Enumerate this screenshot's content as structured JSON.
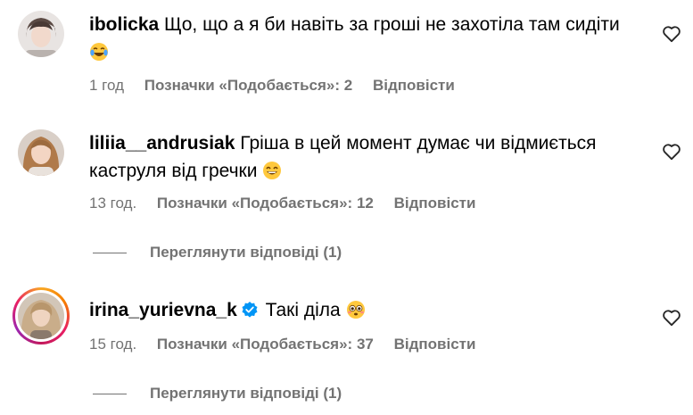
{
  "comments": [
    {
      "username": "ibolicka",
      "text": "Що, що а я би навіть за гроші не захотіла там сидіти",
      "emoji_icon": "laughing-tears-emoji",
      "time": "1 год",
      "likes": "Позначки «Подобається»: 2",
      "reply": "Відповісти"
    },
    {
      "username": "liliia__andrusiak",
      "text": "Гріша в цей момент думає чи відмиється каструля від гречки",
      "emoji_icon": "grinning-emoji",
      "time": "13 год.",
      "likes": "Позначки «Подобається»: 12",
      "reply": "Відповісти",
      "view_replies": "Переглянути відповіді (1)"
    },
    {
      "username": "irina_yurievna_k",
      "verified_icon": "verified-badge-icon",
      "text": "Такі діла",
      "emoji_icon": "flushed-emoji",
      "time": "15 год.",
      "likes": "Позначки «Подобається»: 37",
      "reply": "Відповісти",
      "view_replies": "Переглянути відповіді (1)"
    }
  ],
  "colors": {
    "meta": "#737373",
    "verified": "#0095f6"
  }
}
